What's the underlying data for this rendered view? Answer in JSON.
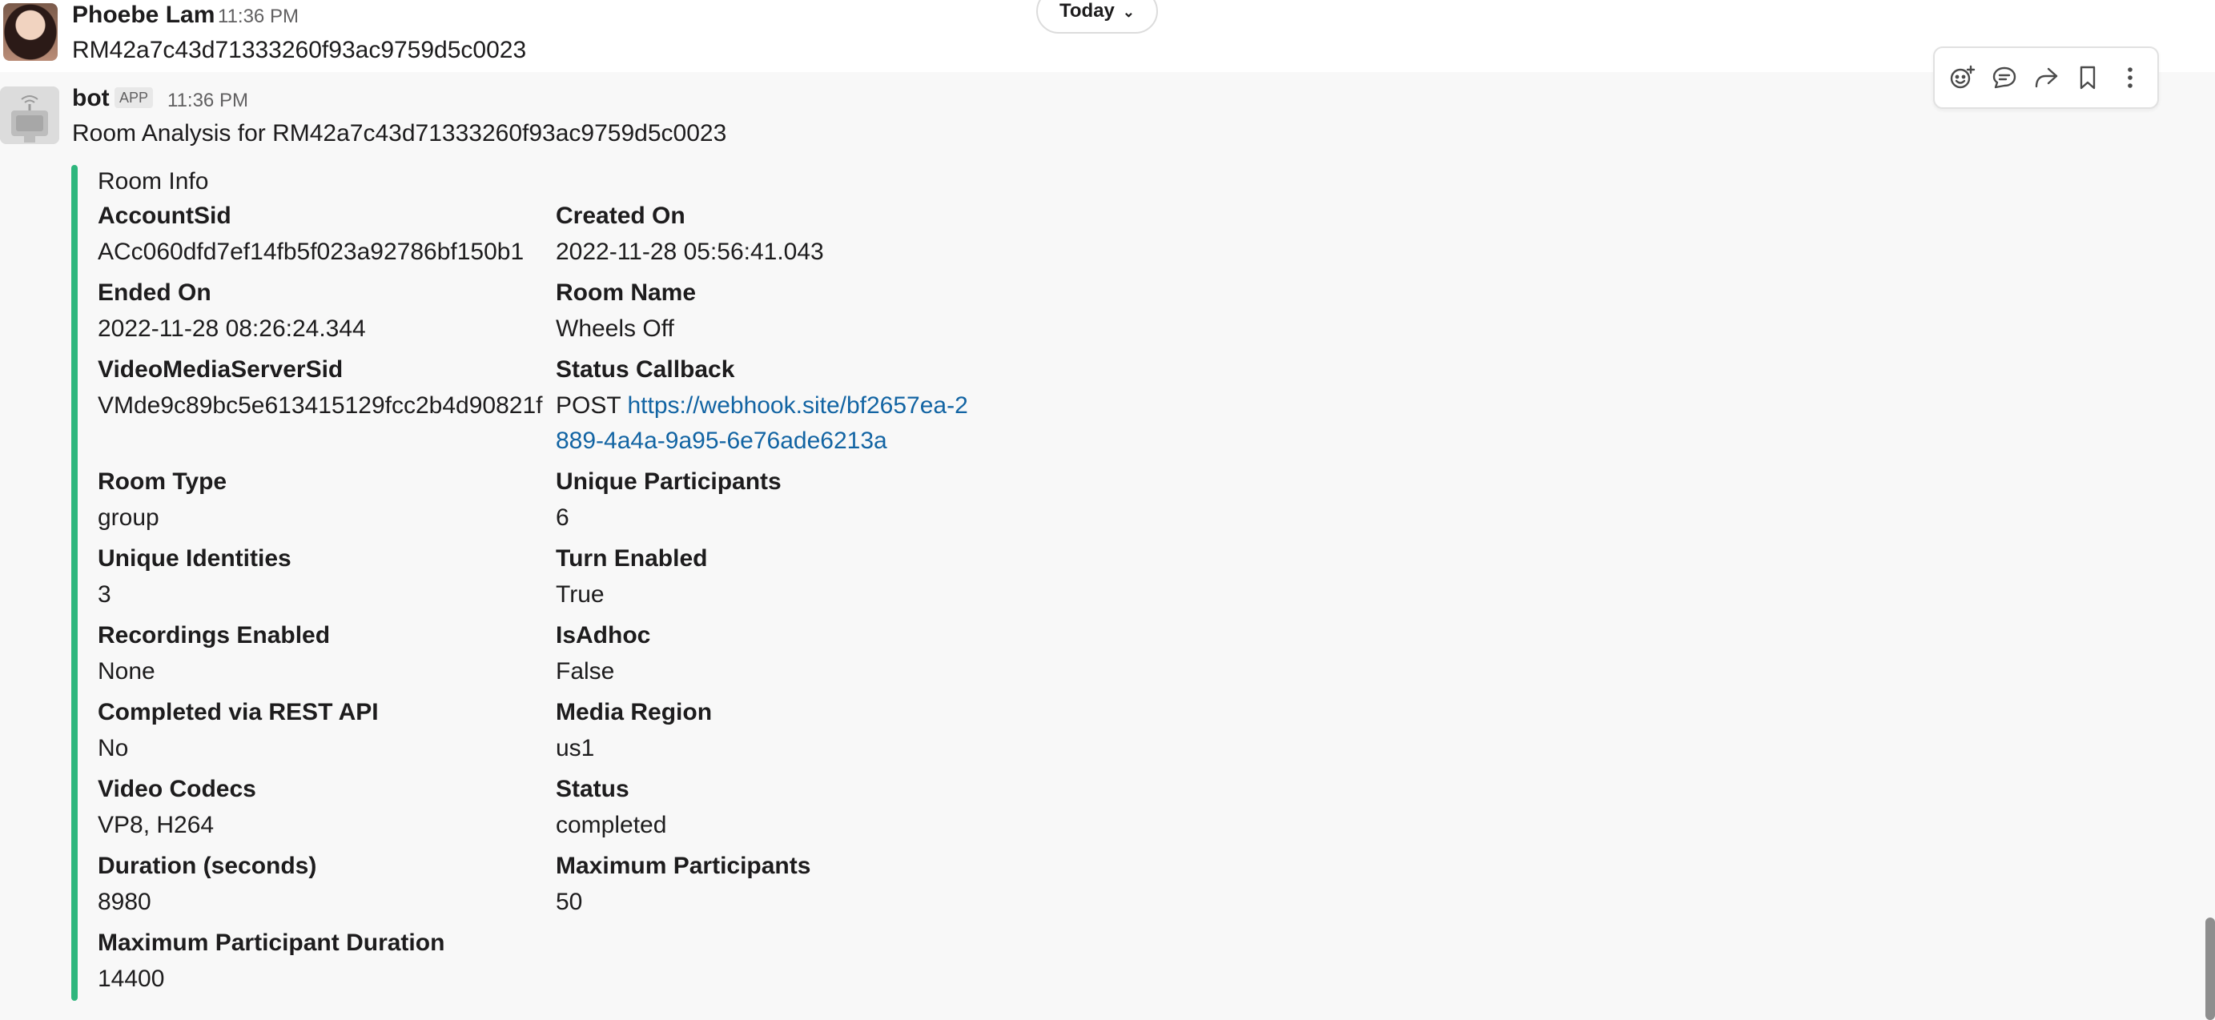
{
  "date_divider": {
    "label": "Today"
  },
  "messages": [
    {
      "author": "Phoebe Lam",
      "time": "11:36 PM",
      "text": "RM42a7c43d71333260f93ac9759d5c0023"
    },
    {
      "author": "bot",
      "badge": "APP",
      "time": "11:36 PM",
      "text": "Room Analysis for RM42a7c43d71333260f93ac9759d5c0023"
    }
  ],
  "attachment": {
    "accent_color": "#2eb67d",
    "title": "Room Info",
    "fields": {
      "account_sid": {
        "label": "AccountSid",
        "value": "ACc060dfd7ef14fb5f023a92786bf150b1"
      },
      "created_on": {
        "label": "Created On",
        "value": "2022-11-28 05:56:41.043"
      },
      "ended_on": {
        "label": "Ended On",
        "value": "2022-11-28 08:26:24.344"
      },
      "room_name": {
        "label": "Room Name",
        "value": "Wheels Off"
      },
      "vms_sid": {
        "label": "VideoMediaServerSid",
        "value": "VMde9c89bc5e613415129fcc2b4d90821f"
      },
      "status_callback": {
        "label": "Status Callback",
        "method": "POST",
        "url": "https://webhook.site/bf2657ea-2889-4a4a-9a95-6e76ade6213a"
      },
      "room_type": {
        "label": "Room Type",
        "value": "group"
      },
      "unique_participants": {
        "label": "Unique Participants",
        "value": "6"
      },
      "unique_identities": {
        "label": "Unique Identities",
        "value": "3"
      },
      "turn_enabled": {
        "label": "Turn Enabled",
        "value": "True"
      },
      "recordings_enabled": {
        "label": "Recordings Enabled",
        "value": "None"
      },
      "is_adhoc": {
        "label": "IsAdhoc",
        "value": "False"
      },
      "completed_via_rest": {
        "label": "Completed via REST API",
        "value": "No"
      },
      "media_region": {
        "label": "Media Region",
        "value": "us1"
      },
      "video_codecs": {
        "label": "Video Codecs",
        "value": "VP8, H264"
      },
      "status": {
        "label": "Status",
        "value": "completed"
      },
      "duration": {
        "label": "Duration (seconds)",
        "value": "8980"
      },
      "max_participants": {
        "label": "Maximum Participants",
        "value": "50"
      },
      "max_participant_duration": {
        "label": "Maximum Participant Duration",
        "value": "14400"
      }
    }
  },
  "message_actions": {
    "icons": [
      "add-reaction-icon",
      "reply-in-thread-icon",
      "share-message-icon",
      "save-bookmark-icon",
      "more-actions-icon"
    ]
  }
}
